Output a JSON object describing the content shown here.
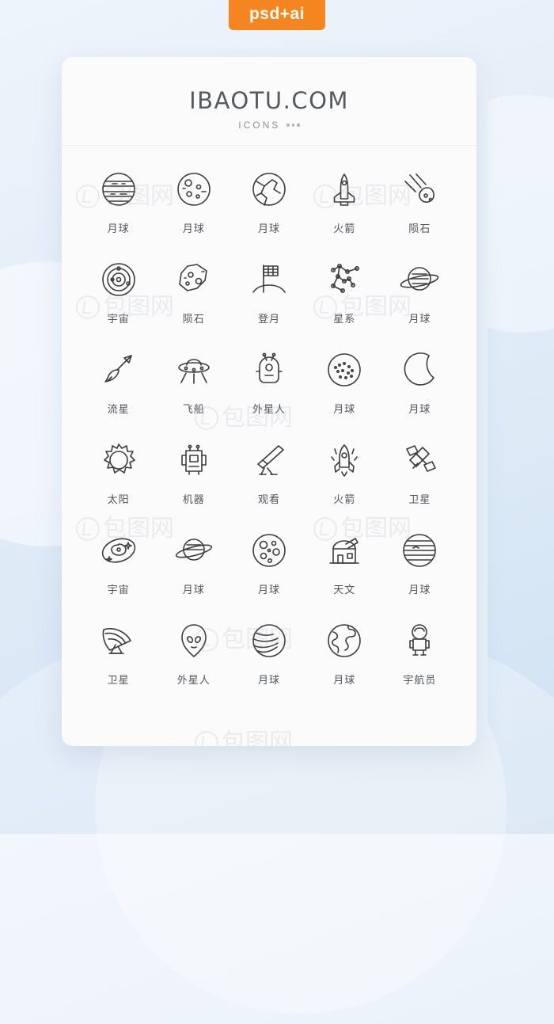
{
  "tag": {
    "label": "psd+ai"
  },
  "card": {
    "brand": "IBAOTU.COM",
    "subtitle": "ICONS"
  },
  "watermarks": [
    {
      "text": "包图网"
    },
    {
      "text": "包图网"
    },
    {
      "text": "包图网"
    },
    {
      "text": "包图网"
    },
    {
      "text": "包图网"
    },
    {
      "text": "包图网"
    },
    {
      "text": "包图网"
    },
    {
      "text": "包图网"
    },
    {
      "text": "包图网"
    }
  ],
  "icons": [
    {
      "label": "月球",
      "name": "planet-stripes-icon"
    },
    {
      "label": "月球",
      "name": "moon-craters-icon"
    },
    {
      "label": "月球",
      "name": "cracked-planet-icon"
    },
    {
      "label": "火箭",
      "name": "space-shuttle-icon"
    },
    {
      "label": "陨石",
      "name": "meteor-streak-icon"
    },
    {
      "label": "宇宙",
      "name": "solar-system-icon"
    },
    {
      "label": "陨石",
      "name": "asteroid-icon"
    },
    {
      "label": "登月",
      "name": "moon-landing-flag-icon"
    },
    {
      "label": "星系",
      "name": "constellation-icon"
    },
    {
      "label": "月球",
      "name": "saturn-icon"
    },
    {
      "label": "流星",
      "name": "shooting-star-icon"
    },
    {
      "label": "飞船",
      "name": "ufo-icon"
    },
    {
      "label": "外星人",
      "name": "alien-robot-icon"
    },
    {
      "label": "月球",
      "name": "moon-dotted-icon"
    },
    {
      "label": "月球",
      "name": "crescent-moon-icon"
    },
    {
      "label": "太阳",
      "name": "sun-icon"
    },
    {
      "label": "机器",
      "name": "rover-machine-icon"
    },
    {
      "label": "观看",
      "name": "telescope-icon"
    },
    {
      "label": "火箭",
      "name": "rocket-launch-icon"
    },
    {
      "label": "卫星",
      "name": "satellite-icon"
    },
    {
      "label": "宇宙",
      "name": "galaxy-spiral-icon"
    },
    {
      "label": "月球",
      "name": "saturn-small-icon"
    },
    {
      "label": "月球",
      "name": "moon-large-craters-icon"
    },
    {
      "label": "天文",
      "name": "observatory-icon"
    },
    {
      "label": "月球",
      "name": "jupiter-icon"
    },
    {
      "label": "卫星",
      "name": "satellite-dish-icon"
    },
    {
      "label": "外星人",
      "name": "alien-head-icon"
    },
    {
      "label": "月球",
      "name": "planet-bands-icon"
    },
    {
      "label": "月球",
      "name": "earth-icon"
    },
    {
      "label": "宇航员",
      "name": "astronaut-icon"
    }
  ]
}
